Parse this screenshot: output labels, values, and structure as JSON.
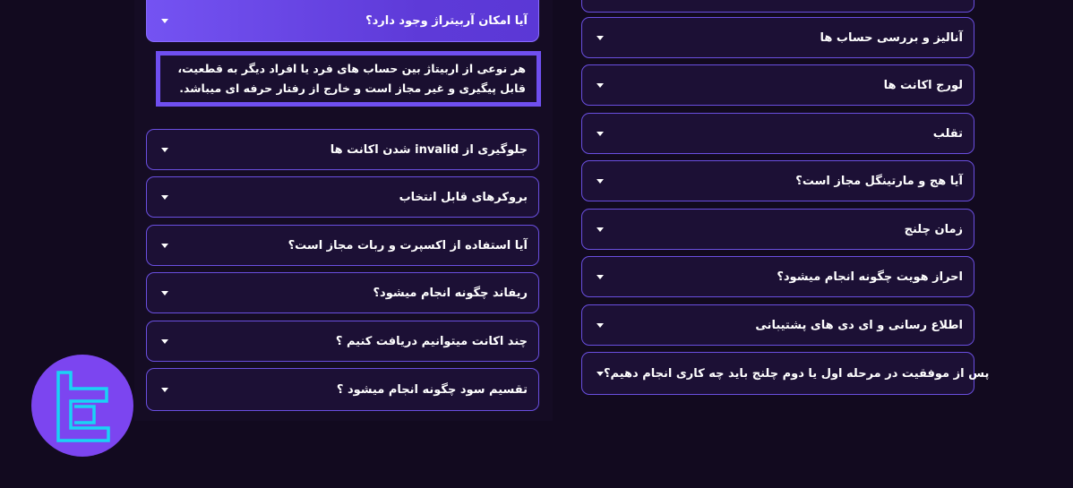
{
  "active_question": {
    "question": "آیا امکان آربیتراژ وجود دارد؟",
    "answer": "هر نوعی از اربیتاژ بین حساب های فرد یا افراد دیگر به قطعیت، قابل پیگیری و غیر مجاز است و خارج از رفتار حرفه ای میباشد."
  },
  "left_questions": [
    "جلوگیری از invalid شدن اکانت ها",
    "بروکرهای قابل انتخاب",
    "آیا استفاده از اکسپرت و ربات مجاز است؟",
    "ریفاند چگونه انجام میشود؟",
    "چند اکانت میتوانیم دریافت کنیم ؟",
    "تقسیم سود چگونه انجام میشود ؟"
  ],
  "right_questions": [
    "آنالیز و بررسی حساب ها",
    "لورج اکانت ها",
    "تقلب",
    "آیا هج و مارتینگل مجاز است؟",
    "زمان چلنج",
    "احراز هویت چگونه انجام میشود؟",
    "اطلاع رسانی و ای دی های پشتیبانی",
    "پس از موفقیت در مرحله اول یا دوم چلنج باید چه کاری انجام دهیم؟"
  ],
  "icons": {
    "caret": "caret-down-icon",
    "logo": "brand-logo-icon"
  },
  "colors": {
    "background": "#120a1f",
    "card": "#1c1035",
    "border": "#6a4fe0",
    "accent": "#7453f2",
    "logo_bg": "#7c45f0",
    "logo_stroke": "#19d3f5"
  }
}
